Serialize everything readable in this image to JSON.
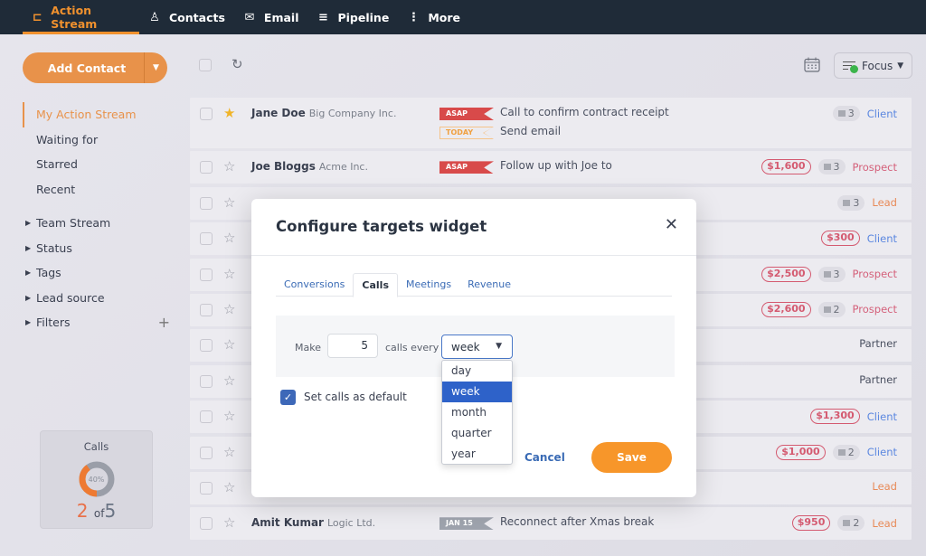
{
  "nav": {
    "items": [
      {
        "label": "Action Stream",
        "icon": "action-stream-icon",
        "active": true
      },
      {
        "label": "Contacts",
        "icon": "person-icon"
      },
      {
        "label": "Email",
        "icon": "envelope-icon"
      },
      {
        "label": "Pipeline",
        "icon": "funnel-icon"
      },
      {
        "label": "More",
        "icon": "kebab-icon"
      }
    ]
  },
  "sidebar": {
    "add_contact_label": "Add Contact",
    "menu": [
      "My Action Stream",
      "Waiting for",
      "Starred",
      "Recent"
    ],
    "groups": [
      "Team Stream",
      "Status",
      "Tags",
      "Lead source",
      "Filters"
    ],
    "widget": {
      "title": "Calls",
      "percent_label": "40%",
      "done": "2",
      "of_label": "of",
      "total": "5",
      "progress": 0.4
    }
  },
  "toolbar": {
    "focus_label": "Focus"
  },
  "rows": [
    {
      "name": "Jane Doe",
      "company": "Big Company Inc.",
      "starred": true,
      "tasks": [
        {
          "tag": "ASAP",
          "kind": "asap",
          "text": "Call to confirm contract receipt"
        },
        {
          "tag": "TODAY",
          "kind": "today",
          "text": "Send email"
        }
      ],
      "money": "",
      "deals": "3",
      "status": "Client"
    },
    {
      "name": "Joe Bloggs",
      "company": "Acme Inc.",
      "starred": false,
      "tasks": [
        {
          "tag": "ASAP",
          "kind": "asap",
          "text": "Follow up with Joe to"
        }
      ],
      "money": "$1,600",
      "deals": "3",
      "status": "Prospect"
    },
    {
      "name": "",
      "company": "",
      "starred": false,
      "tasks": [],
      "money": "",
      "deals": "3",
      "status": "Lead"
    },
    {
      "name": "",
      "company": "",
      "starred": false,
      "tasks": [],
      "money": "$300",
      "deals": "",
      "status": "Client"
    },
    {
      "name": "",
      "company": "",
      "starred": false,
      "tasks": [],
      "money": "$2,500",
      "deals": "3",
      "status": "Prospect"
    },
    {
      "name": "",
      "company": "",
      "starred": false,
      "tasks": [],
      "money": "$2,600",
      "deals": "2",
      "status": "Prospect"
    },
    {
      "name": "",
      "company": "",
      "starred": false,
      "tasks": [],
      "money": "",
      "deals": "",
      "status": "Partner"
    },
    {
      "name": "",
      "company": "",
      "starred": false,
      "tasks": [],
      "money": "",
      "deals": "",
      "status": "Partner"
    },
    {
      "name": "",
      "company": "",
      "starred": false,
      "tasks": [],
      "money": "$1,300",
      "deals": "",
      "status": "Client"
    },
    {
      "name": "",
      "company": "",
      "starred": false,
      "tasks": [],
      "money": "$1,000",
      "deals": "2",
      "status": "Client"
    },
    {
      "name": "",
      "company": "",
      "starred": false,
      "tasks": [],
      "money": "",
      "deals": "",
      "status": "Lead"
    },
    {
      "name": "Amit Kumar",
      "company": "Logic Ltd.",
      "starred": false,
      "tasks": [
        {
          "tag": "JAN 15",
          "kind": "date",
          "text": "Reconnect after Xmas break"
        }
      ],
      "money": "$950",
      "deals": "2",
      "status": "Lead"
    }
  ],
  "modal": {
    "title": "Configure targets widget",
    "tabs": [
      "Conversions",
      "Calls",
      "Meetings",
      "Revenue"
    ],
    "active_tab": "Calls",
    "make_label": "Make",
    "calls_value": "5",
    "calls_every_label": "calls every",
    "period_selected": "week",
    "period_options": [
      "day",
      "week",
      "month",
      "quarter",
      "year"
    ],
    "default_label": "Set calls as default",
    "default_checked": true,
    "cancel_label": "Cancel",
    "save_label": "Save"
  }
}
